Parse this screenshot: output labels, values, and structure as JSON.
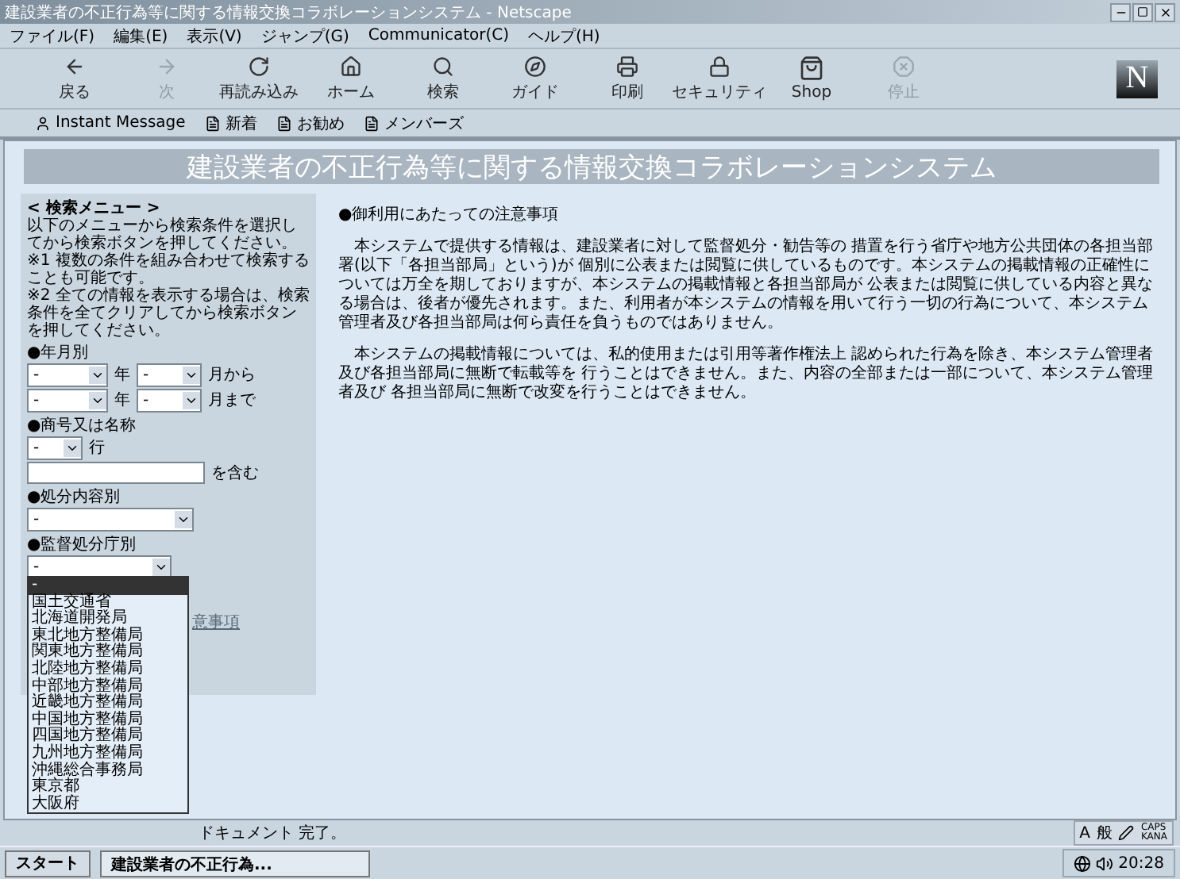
{
  "window": {
    "title": "建設業者の不正行為等に関する情報交換コラボレーションシステム - Netscape"
  },
  "menu": [
    "ファイル(F)",
    "編集(E)",
    "表示(V)",
    "ジャンプ(G)",
    "Communicator(C)",
    "ヘルプ(H)"
  ],
  "toolbar": [
    {
      "kind": "back",
      "label": "戻る",
      "disabled": false
    },
    {
      "kind": "forward",
      "label": "次",
      "disabled": true
    },
    {
      "kind": "reload",
      "label": "再読み込み",
      "disabled": false
    },
    {
      "kind": "home",
      "label": "ホーム",
      "disabled": false
    },
    {
      "kind": "search",
      "label": "検索",
      "disabled": false
    },
    {
      "kind": "guide",
      "label": "ガイド",
      "disabled": false
    },
    {
      "kind": "print",
      "label": "印刷",
      "disabled": false
    },
    {
      "kind": "security",
      "label": "セキュリティ",
      "disabled": false
    },
    {
      "kind": "shop",
      "label": "Shop",
      "disabled": false
    },
    {
      "kind": "stop",
      "label": "停止",
      "disabled": true
    }
  ],
  "logo": "N",
  "personal_toolbar": [
    {
      "kind": "person",
      "label": "Instant Message"
    },
    {
      "kind": "page",
      "label": "新着"
    },
    {
      "kind": "page",
      "label": "お勧め"
    },
    {
      "kind": "page",
      "label": "メンバーズ"
    }
  ],
  "banner": "建設業者の不正行為等に関する情報交換コラボレーションシステム",
  "search_menu": {
    "heading": "< 検索メニュー >",
    "instructions": [
      "以下のメニューから検索条件を選択してから検索ボタンを押してください。",
      "※1 複数の条件を組み合わせて検索することも可能です。",
      "※2 全ての情報を表示する場合は、検索条件を全てクリアしてから検索ボタンを押してください。"
    ],
    "year_month": {
      "label": "●年月別",
      "rows": [
        {
          "year": "-",
          "month": "-",
          "year_unit": "年",
          "suffix": "月から"
        },
        {
          "year": "-",
          "month": "-",
          "year_unit": "年",
          "suffix": "月まで"
        }
      ]
    },
    "name": {
      "label": "●商号又は名称",
      "row_select": "-",
      "row_unit": "行",
      "suffix": "を含む"
    },
    "disposal": {
      "label": "●処分内容別",
      "value": "-"
    },
    "agency": {
      "label": "●監督処分庁別",
      "value": "-",
      "options": [
        {
          "label": "-",
          "selected": true
        },
        {
          "label": "国土交通省",
          "selected": false
        },
        {
          "label": "北海道開発局",
          "selected": false
        },
        {
          "label": "東北地方整備局",
          "selected": false
        },
        {
          "label": "関東地方整備局",
          "selected": false
        },
        {
          "label": "北陸地方整備局",
          "selected": false
        },
        {
          "label": "中部地方整備局",
          "selected": false
        },
        {
          "label": "近畿地方整備局",
          "selected": false
        },
        {
          "label": "中国地方整備局",
          "selected": false
        },
        {
          "label": "四国地方整備局",
          "selected": false
        },
        {
          "label": "九州地方整備局",
          "selected": false
        },
        {
          "label": "沖縄総合事務局",
          "selected": false
        },
        {
          "label": "東京都",
          "selected": false
        },
        {
          "label": "大阪府",
          "selected": false
        }
      ]
    },
    "link": "意事項"
  },
  "notice": {
    "heading": "●御利用にあたっての注意事項",
    "paragraphs": [
      "本システムで提供する情報は、建設業者に対して監督処分・勧告等の 措置を行う省庁や地方公共団体の各担当部署(以下「各担当部局」という)が 個別に公表または閲覧に供しているものです。本システムの掲載情報の正確性については万全を期しておりますが、本システムの掲載情報と各担当部局が 公表または閲覧に供している内容と異なる場合は、後者が優先されます。また、利用者が本システムの情報を用いて行う一切の行為について、本システム管理者及び各担当部局は何ら責任を負うものではありません。",
      "本システムの掲載情報については、私的使用または引用等著作権法上 認められた行為を除き、本システム管理者及び各担当部局に無断で転載等を 行うことはできません。また、内容の全部または一部について、本システム管理者及び 各担当部局に無断で改変を行うことはできません。"
    ]
  },
  "status_bar": "ドキュメント 完了。",
  "ime_bar": {
    "mode": "A",
    "dictionary": "般",
    "caps": "CAPS",
    "kana": "KANA"
  },
  "taskbar": {
    "start": "スタート",
    "task": "建設業者の不正行為...",
    "clock": "20:28"
  }
}
